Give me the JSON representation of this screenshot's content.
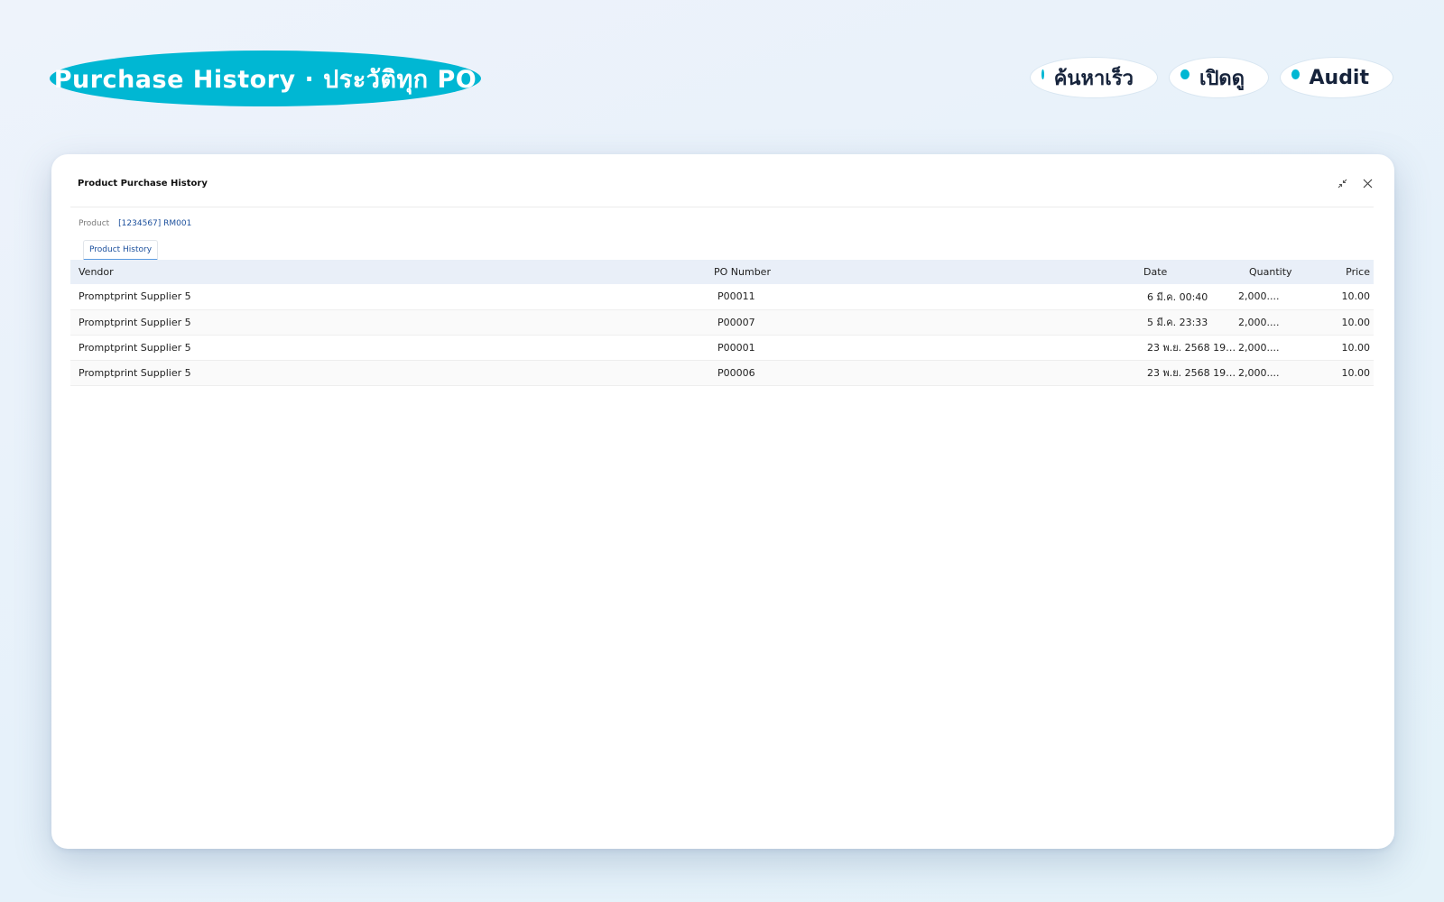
{
  "hero": {
    "title": "Purchase History · ประวัติทุก PO"
  },
  "chips": [
    {
      "label": "ค้นหาเร็ว"
    },
    {
      "label": "เปิดดู"
    },
    {
      "label": "Audit"
    }
  ],
  "colors": {
    "accent": "#00b7d3",
    "link": "#1b4f9c",
    "header_bg": "#e9eff8"
  },
  "window": {
    "title": "Product Purchase History",
    "icons": [
      "minimize-icon",
      "close-icon"
    ],
    "product": {
      "label": "Product",
      "value": "[1234567] RM001"
    },
    "tabs": [
      {
        "label": "Product History",
        "active": true
      }
    ],
    "table": {
      "columns": [
        "Vendor",
        "PO Number",
        "Date",
        "Quantity",
        "Price"
      ],
      "rows": [
        {
          "vendor": "Promptprint Supplier 5",
          "po": "P00011",
          "date": "6 มี.ค. 00:40",
          "quantity": "2,000....",
          "price": "10.00"
        },
        {
          "vendor": "Promptprint Supplier 5",
          "po": "P00007",
          "date": "5 มี.ค. 23:33",
          "quantity": "2,000....",
          "price": "10.00"
        },
        {
          "vendor": "Promptprint Supplier 5",
          "po": "P00001",
          "date": "23 พ.ย. 2568 19:...",
          "quantity": "2,000....",
          "price": "10.00"
        },
        {
          "vendor": "Promptprint Supplier 5",
          "po": "P00006",
          "date": "23 พ.ย. 2568 19:...",
          "quantity": "2,000....",
          "price": "10.00"
        }
      ]
    }
  }
}
